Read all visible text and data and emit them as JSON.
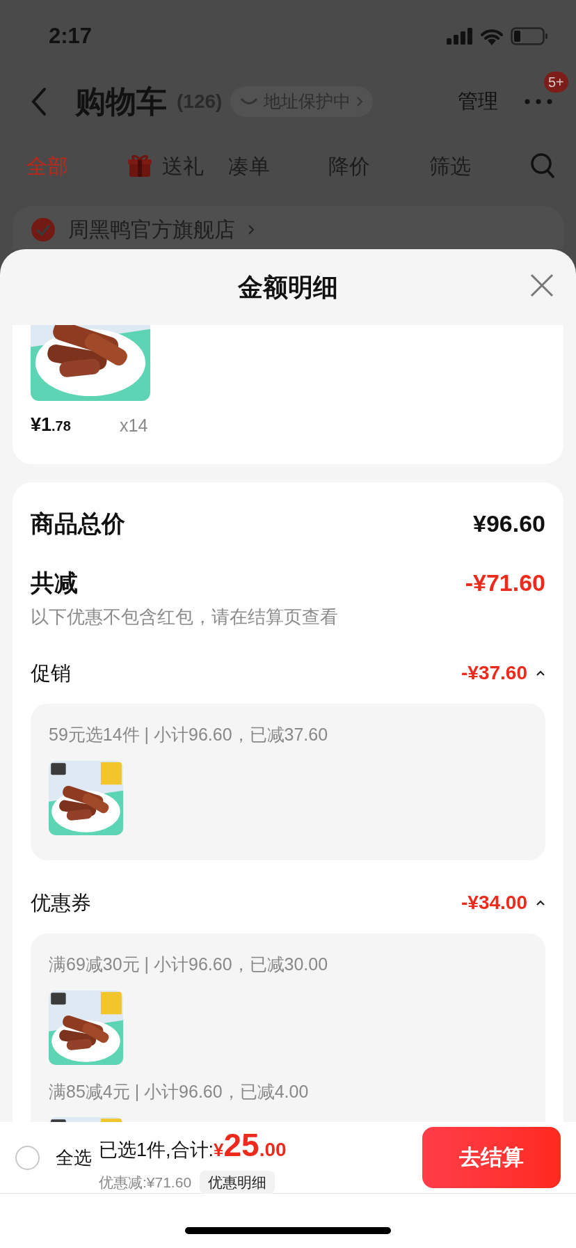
{
  "status_bar": {
    "time": "2:17"
  },
  "header": {
    "title": "购物车",
    "count": "(126)",
    "address_badge": "地址保护中",
    "manage": "管理",
    "more_badge": "5+"
  },
  "tabs": [
    {
      "label": "全部",
      "selected": true,
      "kind": "text"
    },
    {
      "label": "送礼",
      "selected": false,
      "kind": "gift"
    },
    {
      "label": "凑单",
      "selected": false,
      "kind": "text"
    },
    {
      "label": "降价",
      "selected": false,
      "kind": "text"
    },
    {
      "label": "筛选",
      "selected": false,
      "kind": "text"
    }
  ],
  "store": {
    "name": "周黑鸭官方旗舰店",
    "checked": true
  },
  "sheet": {
    "title": "金额明细",
    "item": {
      "price_main": "¥1",
      "price_decimal": ".78",
      "quantity": "x14"
    },
    "summary": {
      "total_label": "商品总价",
      "total_value": "¥96.60",
      "discount_label": "共减",
      "discount_value": "-¥71.60",
      "note": "以下优惠不包含红包，请在结算页查看"
    },
    "sections": [
      {
        "title": "促销",
        "amount": "-¥37.60",
        "expanded": true,
        "groups": [
          {
            "rule": "59元选14件 | 小计96.60，已减37.60"
          }
        ]
      },
      {
        "title": "优惠券",
        "amount": "-¥34.00",
        "expanded": true,
        "groups": [
          {
            "rule": "满69减30元 | 小计96.60，已减30.00"
          },
          {
            "rule": "满85减4元 | 小计96.60，已减4.00"
          }
        ]
      }
    ]
  },
  "bottom_bar": {
    "select_all": {
      "label": "全选",
      "checked": false
    },
    "selected_text": "已选1件,合计:",
    "currency": "¥",
    "amount_int": "25",
    "amount_dec": ".00",
    "discount_text": "优惠减:¥71.60",
    "detail_button": "优惠明细",
    "checkout": "去结算"
  }
}
